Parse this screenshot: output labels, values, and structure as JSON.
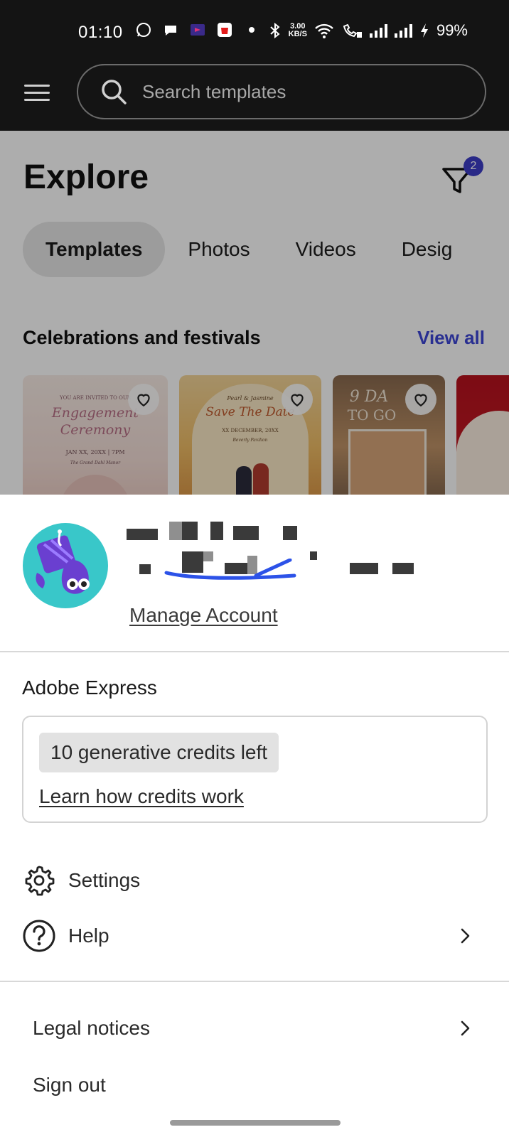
{
  "status_bar": {
    "time": "01:10",
    "net_speed_value": "3.00",
    "net_speed_unit": "KB/S",
    "battery": "99%",
    "icons": [
      "whatsapp-icon",
      "chat-icon",
      "sony-liv-icon",
      "shopping-bag-icon",
      "dot-icon",
      "bluetooth-icon",
      "wifi-icon",
      "wifi-calling-icon",
      "signal-icon",
      "signal-icon",
      "charging-icon"
    ]
  },
  "search": {
    "placeholder": "Search templates"
  },
  "explore": {
    "title": "Explore",
    "filter_count": "2",
    "tabs": [
      {
        "label": "Templates",
        "active": true
      },
      {
        "label": "Photos",
        "active": false
      },
      {
        "label": "Videos",
        "active": false
      },
      {
        "label": "Desig",
        "active": false
      }
    ],
    "section_title": "Celebrations and festivals",
    "view_all": "View all",
    "cards": [
      {
        "lines": [
          "YOU ARE INVITED TO OUR",
          "Engagement",
          "Ceremony",
          "JAN XX, 20XX | 7PM",
          "The Grand Dahl Manor"
        ]
      },
      {
        "lines": [
          "Pearl & Jasmine",
          "Save The Date",
          "XX DECEMBER, 20XX",
          "Beverly Pavilion"
        ]
      },
      {
        "lines": [
          "9 DA",
          "TO GO"
        ]
      },
      {
        "lines": []
      }
    ]
  },
  "sheet": {
    "manage_account": "Manage Account",
    "app_name": "Adobe Express",
    "credits": "10 generative credits left",
    "credits_link": "Learn how credits work",
    "menu": {
      "settings": "Settings",
      "help": "Help",
      "legal": "Legal notices",
      "sign_out": "Sign out"
    }
  },
  "colors": {
    "accent": "#3d46d6",
    "badge": "#3d3dc8",
    "avatar_bg": "#39c7c9",
    "header_bg": "#141414"
  }
}
